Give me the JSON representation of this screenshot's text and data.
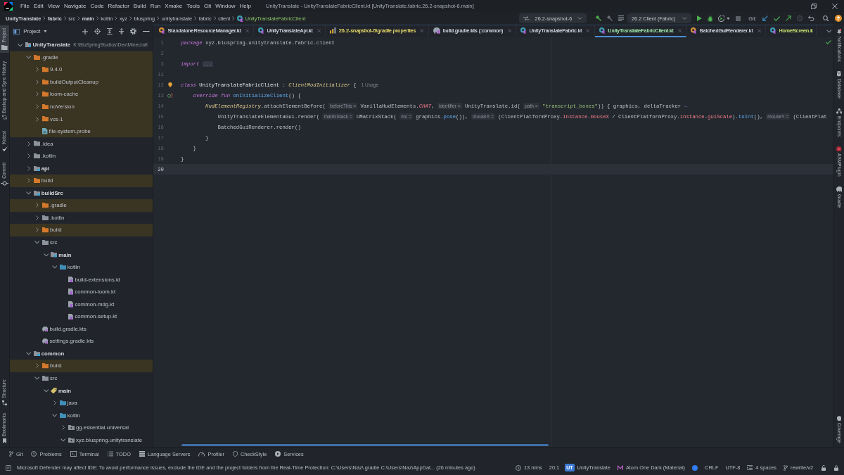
{
  "window": {
    "title": "UnityTranslate - UnityTranslateFabricClient.kt [UnityTranslate.fabric.26.2-snapshot-6.main]"
  },
  "menu": [
    "File",
    "Edit",
    "View",
    "Navigate",
    "Code",
    "Refactor",
    "Build",
    "Run",
    "Xmake",
    "Tools",
    "Git",
    "Window",
    "Help"
  ],
  "breadcrumbs": [
    {
      "label": "UnityTranslate",
      "kind": "module"
    },
    {
      "label": "fabric",
      "kind": "module"
    },
    {
      "label": "src",
      "kind": "folder"
    },
    {
      "label": "main",
      "kind": "module"
    },
    {
      "label": "kotlin",
      "kind": "folder"
    },
    {
      "label": "xyz",
      "kind": "folder"
    },
    {
      "label": "bluspring",
      "kind": "folder"
    },
    {
      "label": "unitytranslate",
      "kind": "folder"
    },
    {
      "label": "fabric",
      "kind": "folder"
    },
    {
      "label": "client",
      "kind": "folder"
    },
    {
      "label": "UnityTranslateFabricClient",
      "kind": "file"
    }
  ],
  "toolbar": {
    "branch_selector": "26.2-snapshot-6",
    "run_configuration": "26.2 Client (Fabric)",
    "git_label": "Git:"
  },
  "left_stripe": {
    "top": [
      {
        "label": "Project",
        "selected": true
      },
      {
        "label": "Backup and Sync History",
        "selected": false
      },
      {
        "label": "Kotest",
        "selected": false
      },
      {
        "label": "Commit",
        "selected": false
      }
    ],
    "bottom": [
      {
        "label": "Structure",
        "selected": false
      },
      {
        "label": "Bookmarks",
        "selected": false
      }
    ]
  },
  "project_panel": {
    "title": "Project",
    "tree": [
      {
        "name": "UnityTranslate",
        "path": "K:\\BluSpringStudios\\Dev\\Minecraft",
        "kind": "module",
        "expanded": true,
        "excluded": false,
        "children": [
          {
            "name": ".gradle",
            "kind": "folder",
            "expanded": true,
            "excluded": true,
            "children": [
              {
                "name": "9.4.0",
                "kind": "folder",
                "expanded": false,
                "excluded": true
              },
              {
                "name": "buildOutputCleanup",
                "kind": "folder",
                "expanded": false,
                "excluded": true
              },
              {
                "name": "loom-cache",
                "kind": "folder",
                "expanded": false,
                "excluded": true
              },
              {
                "name": "noVersion",
                "kind": "folder",
                "expanded": false,
                "excluded": true
              },
              {
                "name": "vcs-1",
                "kind": "folder",
                "expanded": false,
                "excluded": true
              },
              {
                "name": "file-system.probe",
                "kind": "file",
                "excluded": true
              }
            ]
          },
          {
            "name": ".idea",
            "kind": "folder",
            "expanded": false,
            "excluded": false
          },
          {
            "name": ".kotlin",
            "kind": "folder",
            "expanded": false,
            "excluded": false
          },
          {
            "name": "api",
            "kind": "module",
            "expanded": false,
            "excluded": false
          },
          {
            "name": "build",
            "kind": "folder",
            "expanded": false,
            "excluded": true
          },
          {
            "name": "buildSrc",
            "kind": "module",
            "expanded": true,
            "excluded": false,
            "children": [
              {
                "name": ".gradle",
                "kind": "folder",
                "expanded": false,
                "excluded": true
              },
              {
                "name": ".kotlin",
                "kind": "folder",
                "expanded": false,
                "excluded": false
              },
              {
                "name": "build",
                "kind": "folder",
                "expanded": false,
                "excluded": true
              },
              {
                "name": "src",
                "kind": "folder",
                "expanded": true,
                "excluded": false,
                "children": [
                  {
                    "name": "main",
                    "kind": "module",
                    "expanded": true,
                    "excluded": false,
                    "children": [
                      {
                        "name": "kotlin",
                        "kind": "source-root",
                        "expanded": true,
                        "excluded": false,
                        "children": [
                          {
                            "name": "build-extensions.kt",
                            "kind": "kotlin-file",
                            "excluded": false
                          },
                          {
                            "name": "common-loom.kt",
                            "kind": "kotlin-file",
                            "excluded": false
                          },
                          {
                            "name": "common-mdg.kt",
                            "kind": "kotlin-file",
                            "excluded": false
                          },
                          {
                            "name": "common-setup.kt",
                            "kind": "kotlin-file",
                            "excluded": false
                          }
                        ]
                      }
                    ]
                  }
                ]
              },
              {
                "name": "build.gradle.kts",
                "kind": "gradle-script",
                "excluded": false
              },
              {
                "name": "settings.gradle.kts",
                "kind": "gradle-script",
                "excluded": false
              }
            ]
          },
          {
            "name": "common",
            "kind": "module",
            "expanded": true,
            "excluded": false,
            "children": [
              {
                "name": "build",
                "kind": "folder",
                "expanded": false,
                "excluded": true
              },
              {
                "name": "src",
                "kind": "folder",
                "expanded": true,
                "excluded": false,
                "children": [
                  {
                    "name": "main",
                    "kind": "source-set",
                    "expanded": true,
                    "excluded": false,
                    "children": [
                      {
                        "name": "java",
                        "kind": "source-root",
                        "expanded": false,
                        "excluded": false
                      },
                      {
                        "name": "kotlin",
                        "kind": "source-root",
                        "expanded": true,
                        "excluded": false,
                        "children": [
                          {
                            "name": "gg.essential.universal",
                            "kind": "package",
                            "expanded": false,
                            "excluded": false
                          },
                          {
                            "name": "xyz.bluspring.unitytranslate",
                            "kind": "package",
                            "expanded": true,
                            "excluded": false
                          }
                        ]
                      }
                    ]
                  }
                ]
              }
            ]
          }
        ]
      }
    ]
  },
  "tabs": [
    {
      "label": "StandaloneResourceManager.kt",
      "kind": "object",
      "selected": false,
      "closable": true,
      "color": "#b9bec7"
    },
    {
      "label": "UnityTranslateApi.kt",
      "kind": "class",
      "selected": false,
      "closable": true,
      "color": "#b9bec7"
    },
    {
      "label": "26.2-snapshot-6\\gradle.properties",
      "kind": "properties",
      "selected": false,
      "closable": true,
      "color": "#cbbf63"
    },
    {
      "label": "build.gradle.kts (:common)",
      "kind": "gradle-script",
      "selected": false,
      "closable": true,
      "color": "#b9bec7"
    },
    {
      "label": "UnityTranslateFabric.kt",
      "kind": "class",
      "selected": false,
      "closable": true,
      "color": "#b9bec7"
    },
    {
      "label": "UnityTranslateFabricClient.kt",
      "kind": "class",
      "selected": true,
      "closable": true,
      "color": "#8fcf9b"
    },
    {
      "label": "BatchedGuiRenderer.kt",
      "kind": "object",
      "selected": false,
      "closable": true,
      "color": "#b9bec7"
    },
    {
      "label": "HomeScreen.k",
      "kind": "class",
      "selected": false,
      "closable": false,
      "color": "#b3c86b"
    }
  ],
  "editor": {
    "lines": [
      {
        "number": "1",
        "kind": "code",
        "current": false,
        "segments": [
          {
            "text": "package",
            "kind": "keyword"
          },
          {
            "text": " xyz.bluspring.unitytranslate.fabric.client",
            "kind": "plain"
          }
        ]
      },
      {
        "number": "2",
        "kind": "code",
        "current": false
      },
      {
        "number": "3",
        "kind": "code",
        "current": false,
        "segments": [
          {
            "text": "import",
            "kind": "keyword"
          },
          {
            "text": "...",
            "kind": "folded"
          }
        ]
      },
      {
        "number": "11",
        "kind": "code",
        "current": false
      },
      {
        "number": "12",
        "kind": "intention",
        "current": false,
        "segments": [
          {
            "text": "class",
            "kind": "keyword"
          },
          {
            "text": " UnityTranslateFabricClient",
            "kind": "declaration"
          },
          {
            "text": " : ",
            "kind": "plain"
          },
          {
            "text": "ClientModInitializer",
            "kind": "italic"
          },
          {
            "text": " {",
            "kind": "plain"
          }
        ],
        "usage": "1 Usage"
      },
      {
        "number": "13",
        "kind": "override",
        "current": false,
        "segments": [
          {
            "text": "    override fun",
            "kind": "keyword"
          },
          {
            "text": " onInitializeClient",
            "kind": "function"
          },
          {
            "text": "() {",
            "kind": "plain"
          }
        ]
      },
      {
        "number": "14",
        "kind": "code",
        "current": false,
        "segments": [
          {
            "text": "        HudElementRegistry",
            "kind": "italic"
          },
          {
            "text": ".attachElementBefore(",
            "kind": "plain"
          },
          {
            "text": "beforeThis =",
            "kind": "hint"
          },
          {
            "text": "VanillaHudElements.",
            "kind": "plain"
          },
          {
            "text": "CHAT",
            "kind": "constant"
          },
          {
            "text": ",",
            "kind": "plain"
          },
          {
            "text": "identifier =",
            "kind": "hint"
          },
          {
            "text": "UnityTranslate.id(",
            "kind": "plain"
          },
          {
            "text": "path =",
            "kind": "hint"
          },
          {
            "text": "\"transcript_boxes\"",
            "kind": "string"
          },
          {
            "text": ")) { graphics, deltaTracker ",
            "kind": "plain"
          },
          {
            "text": "→",
            "kind": "operator"
          }
        ]
      },
      {
        "number": "15",
        "kind": "code",
        "current": false,
        "segments": [
          {
            "text": "            UnityTranslateElementaGui.render(",
            "kind": "plain"
          },
          {
            "text": "matrixStack =",
            "kind": "hint"
          },
          {
            "text": "UMatrixStack(",
            "kind": "plain"
          },
          {
            "text": "mc =",
            "kind": "hint"
          },
          {
            "text": "graphics.",
            "kind": "plain"
          },
          {
            "text": "pose",
            "kind": "function"
          },
          {
            "text": "()),",
            "kind": "plain"
          },
          {
            "text": "mouseX =",
            "kind": "hint"
          },
          {
            "text": "(ClientPlatformProxy.",
            "kind": "plain"
          },
          {
            "text": "instance",
            "kind": "property"
          },
          {
            "text": ".",
            "kind": "plain"
          },
          {
            "text": "mouseX",
            "kind": "property"
          },
          {
            "text": " / ClientPlatformProxy.",
            "kind": "plain"
          },
          {
            "text": "instance",
            "kind": "property"
          },
          {
            "text": ".",
            "kind": "plain"
          },
          {
            "text": "guiScale",
            "kind": "property"
          },
          {
            "text": ").",
            "kind": "plain"
          },
          {
            "text": "toInt",
            "kind": "function"
          },
          {
            "text": "(),",
            "kind": "plain"
          },
          {
            "text": "mouseY =",
            "kind": "hint"
          },
          {
            "text": "(ClientPlat",
            "kind": "plain"
          }
        ]
      },
      {
        "number": "16",
        "kind": "code",
        "current": false,
        "segments": [
          {
            "text": "            BatchedGuiRenderer.render()",
            "kind": "plain"
          }
        ]
      },
      {
        "number": "17",
        "kind": "code",
        "current": false,
        "segments": [
          {
            "text": "        }",
            "kind": "plain"
          }
        ]
      },
      {
        "number": "18",
        "kind": "code",
        "current": false,
        "segments": [
          {
            "text": "    }",
            "kind": "plain"
          }
        ]
      },
      {
        "number": "19",
        "kind": "code",
        "current": false,
        "segments": [
          {
            "text": "}",
            "kind": "plain"
          }
        ]
      },
      {
        "number": "20",
        "kind": "code",
        "current": true
      }
    ]
  },
  "right_stripe": {
    "top": [
      {
        "label": "Notifications",
        "selected": false
      },
      {
        "label": "Database",
        "selected": false
      },
      {
        "label": "Endpoints",
        "selected": false
      },
      {
        "label": "ASMPlugin",
        "selected": false
      },
      {
        "label": "Gradle",
        "selected": false
      }
    ],
    "bottom": [
      {
        "label": "Coverage",
        "selected": false
      }
    ]
  },
  "tool_windows": [
    "Git",
    "Problems",
    "Terminal",
    "TODO",
    "Language Servers",
    "Profiler",
    "CheckStyle",
    "Services"
  ],
  "status_bar": {
    "message": "Microsoft Defender may affect IDE: To avoid performance issues, exclude the IDE and the project folders from the Real-Time Protection: C:\\Users\\Naz\\.gradle C:\\Users\\Naz\\AppDat... (26 minutes ago)",
    "elapsed": "13 mins",
    "position": "20:1",
    "project_badge": "UT",
    "project": "UnityTranslate",
    "theme": "Atom One Dark (Material)",
    "line_separator": "CRLF",
    "encoding": "UTF-8",
    "indent": "4 spaces",
    "branch": "rewrite/v2"
  }
}
